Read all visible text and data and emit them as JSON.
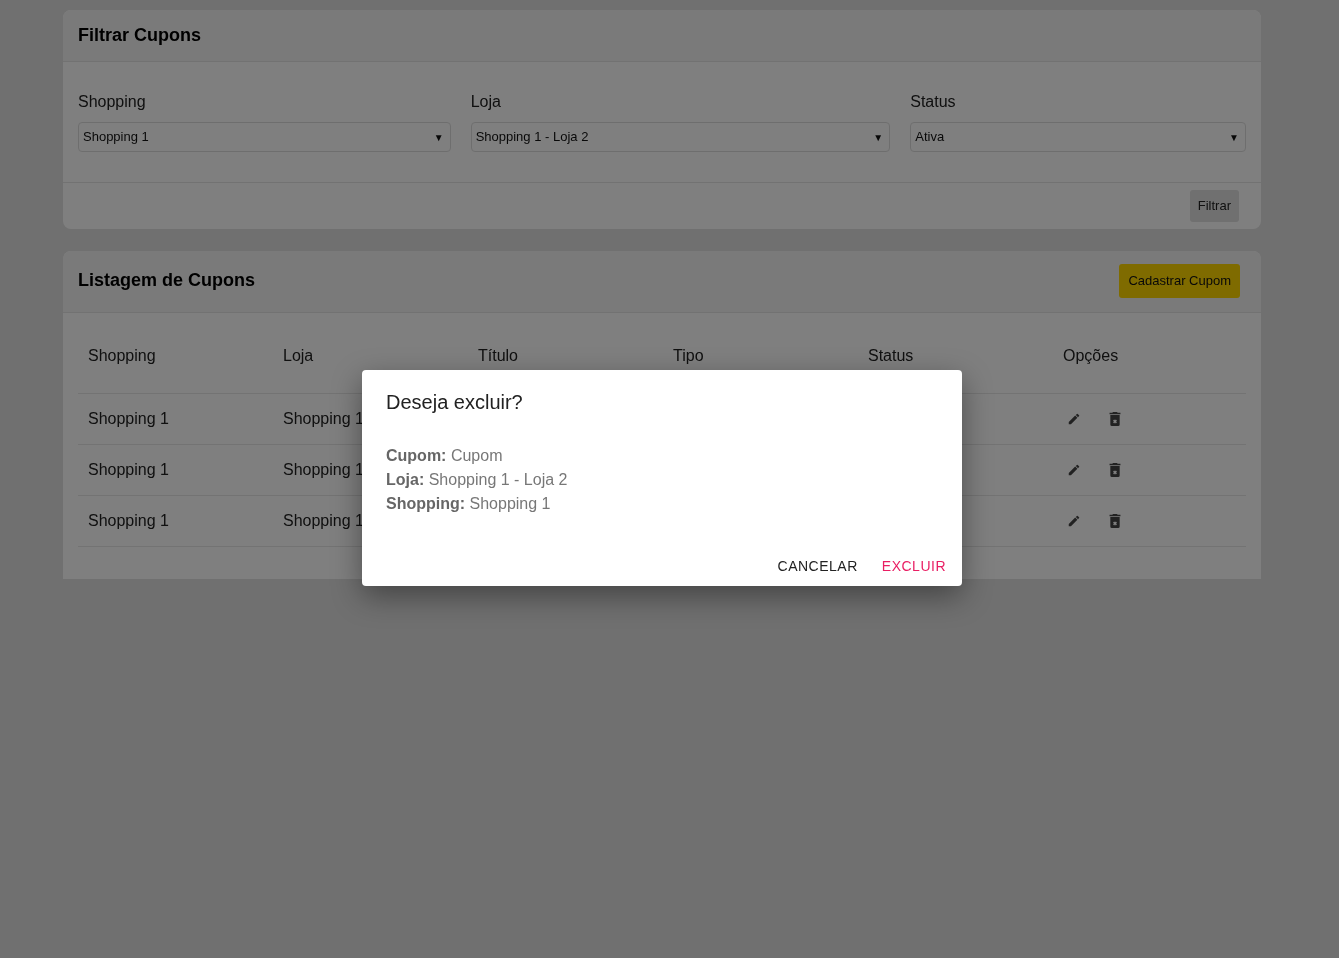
{
  "filter_card": {
    "title": "Filtrar Cupons",
    "fields": [
      {
        "label": "Shopping",
        "value": "Shopping 1"
      },
      {
        "label": "Loja",
        "value": "Shopping 1 - Loja 2"
      },
      {
        "label": "Status",
        "value": "Ativa"
      }
    ],
    "caret": "▼",
    "button": "Filtrar"
  },
  "list_card": {
    "title": "Listagem de Cupons",
    "button": "Cadastrar Cupom",
    "table": {
      "columns": [
        "Shopping",
        "Loja",
        "Título",
        "Tipo",
        "Status",
        "Opções"
      ],
      "rows": [
        {
          "shopping": "Shopping 1",
          "loja": "Shopping 1"
        },
        {
          "shopping": "Shopping 1",
          "loja": "Shopping 1"
        },
        {
          "shopping": "Shopping 1",
          "loja": "Shopping 1"
        }
      ]
    }
  },
  "dialog": {
    "title": "Deseja excluir?",
    "details": [
      {
        "label": "Cupom:",
        "value": "Cupom"
      },
      {
        "label": "Loja:",
        "value": "Shopping 1 - Loja 2"
      },
      {
        "label": "Shopping:",
        "value": "Shopping 1"
      }
    ],
    "buttons": [
      {
        "label": "CANCELAR",
        "kind": "neutral"
      },
      {
        "label": "EXCLUIR",
        "kind": "danger"
      }
    ]
  }
}
